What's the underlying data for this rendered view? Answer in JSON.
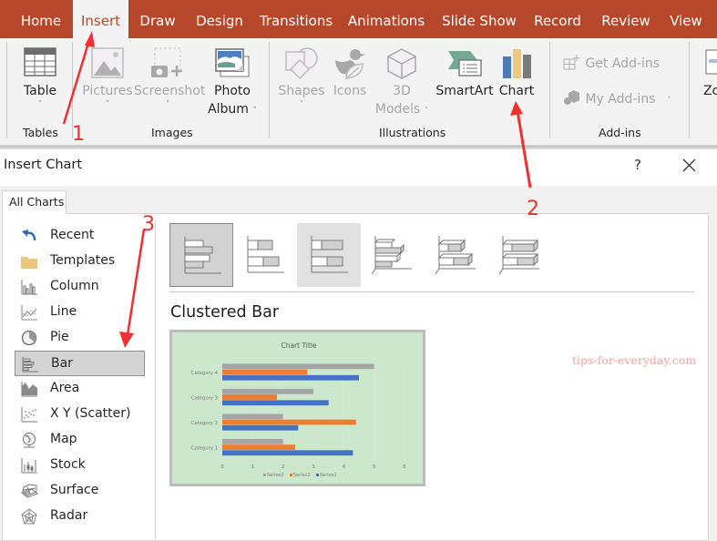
{
  "ribbon_tabs": [
    {
      "label": "Home",
      "active": false
    },
    {
      "label": "Insert",
      "active": true
    },
    {
      "label": "Draw",
      "active": false
    },
    {
      "label": "Design",
      "active": false
    },
    {
      "label": "Transitions",
      "active": false
    },
    {
      "label": "Animations",
      "active": false
    },
    {
      "label": "Slide Show",
      "active": false
    },
    {
      "label": "Record",
      "active": false
    },
    {
      "label": "Review",
      "active": false
    },
    {
      "label": "View",
      "active": false
    }
  ],
  "ribbon": {
    "buttons": {
      "table": {
        "label": "Table",
        "enabled": true,
        "icon": "table-icon"
      },
      "pictures": {
        "label": "Pictures",
        "enabled": false,
        "icon": "pictures-icon"
      },
      "screenshot": {
        "label": "Screenshot",
        "enabled": false,
        "icon": "screenshot-icon"
      },
      "photo_album": {
        "label_line1": "Photo",
        "label_line2": "Album",
        "enabled": true,
        "icon": "photo-album-icon"
      },
      "shapes": {
        "label": "Shapes",
        "enabled": false,
        "icon": "shapes-icon"
      },
      "icons": {
        "label": "Icons",
        "enabled": false,
        "icon": "icons-icon"
      },
      "models_3d": {
        "label_line1": "3D",
        "label_line2": "Models",
        "enabled": false,
        "icon": "3d-models-icon"
      },
      "smartart": {
        "label": "SmartArt",
        "enabled": true,
        "icon": "smartart-icon"
      },
      "chart": {
        "label": "Chart",
        "enabled": true,
        "icon": "chart-icon"
      },
      "get_addins": {
        "label": "Get Add-ins",
        "enabled": false,
        "icon": "get-addins-icon"
      },
      "my_addins": {
        "label": "My Add-ins",
        "enabled": false,
        "icon": "my-addins-icon"
      },
      "zoom": {
        "label": "Zo",
        "enabled": true,
        "icon": "zoom-icon"
      }
    },
    "groups": {
      "tables": "Tables",
      "images": "Images",
      "illustrations": "Illustrations",
      "addins": "Add-ins"
    },
    "chevron": "˅"
  },
  "dialog": {
    "title": "Insert Chart",
    "help": "?",
    "tab": "All Charts",
    "categories": [
      {
        "label": "Recent",
        "icon": "recent-icon",
        "selected": false
      },
      {
        "label": "Templates",
        "icon": "templates-folder-icon",
        "selected": false
      },
      {
        "label": "Column",
        "icon": "column-chart-icon",
        "selected": false
      },
      {
        "label": "Line",
        "icon": "line-chart-icon",
        "selected": false
      },
      {
        "label": "Pie",
        "icon": "pie-chart-icon",
        "selected": false
      },
      {
        "label": "Bar",
        "icon": "bar-chart-icon",
        "selected": true
      },
      {
        "label": "Area",
        "icon": "area-chart-icon",
        "selected": false
      },
      {
        "label": "X Y (Scatter)",
        "icon": "scatter-chart-icon",
        "selected": false
      },
      {
        "label": "Map",
        "icon": "map-chart-icon",
        "selected": false
      },
      {
        "label": "Stock",
        "icon": "stock-chart-icon",
        "selected": false
      },
      {
        "label": "Surface",
        "icon": "surface-chart-icon",
        "selected": false
      },
      {
        "label": "Radar",
        "icon": "radar-chart-icon",
        "selected": false
      }
    ],
    "subtypes": [
      {
        "name": "clustered-bar",
        "selected": true
      },
      {
        "name": "stacked-bar",
        "selected": false
      },
      {
        "name": "100-stacked-bar",
        "selected": false,
        "hovered": true
      },
      {
        "name": "3d-clustered-bar",
        "selected": false
      },
      {
        "name": "3d-stacked-bar",
        "selected": false
      },
      {
        "name": "3d-100-stacked-bar",
        "selected": false
      }
    ],
    "selected_subtype_title": "Clustered Bar"
  },
  "chart_data": {
    "type": "bar",
    "orientation": "horizontal",
    "title": "Chart Title",
    "categories": [
      "Category 1",
      "Category 2",
      "Category 3",
      "Category 4"
    ],
    "series": [
      {
        "name": "Series1",
        "color": "#4472c4",
        "values": [
          4.3,
          2.5,
          3.5,
          4.5
        ]
      },
      {
        "name": "Series2",
        "color": "#ed7d31",
        "values": [
          2.4,
          4.4,
          1.8,
          2.8
        ]
      },
      {
        "name": "Series3",
        "color": "#a5a5a5",
        "values": [
          2,
          2,
          3,
          5
        ]
      }
    ],
    "legend_order": [
      "Series3",
      "Series2",
      "Series1"
    ],
    "xlim": [
      0,
      6
    ],
    "xticks": [
      "0",
      "1",
      "2",
      "3",
      "4",
      "5",
      "6"
    ],
    "grid": true,
    "legend": "bottom",
    "background": "#cbe8cd"
  },
  "annotations": {
    "step1": "1",
    "step2": "2",
    "step3": "3",
    "color": "#f03030"
  },
  "watermark": "tips-for-everyday.com",
  "colors": {
    "ribbon_tab_bar": "#b7472a",
    "ribbon_bg": "#f3f3f3"
  }
}
